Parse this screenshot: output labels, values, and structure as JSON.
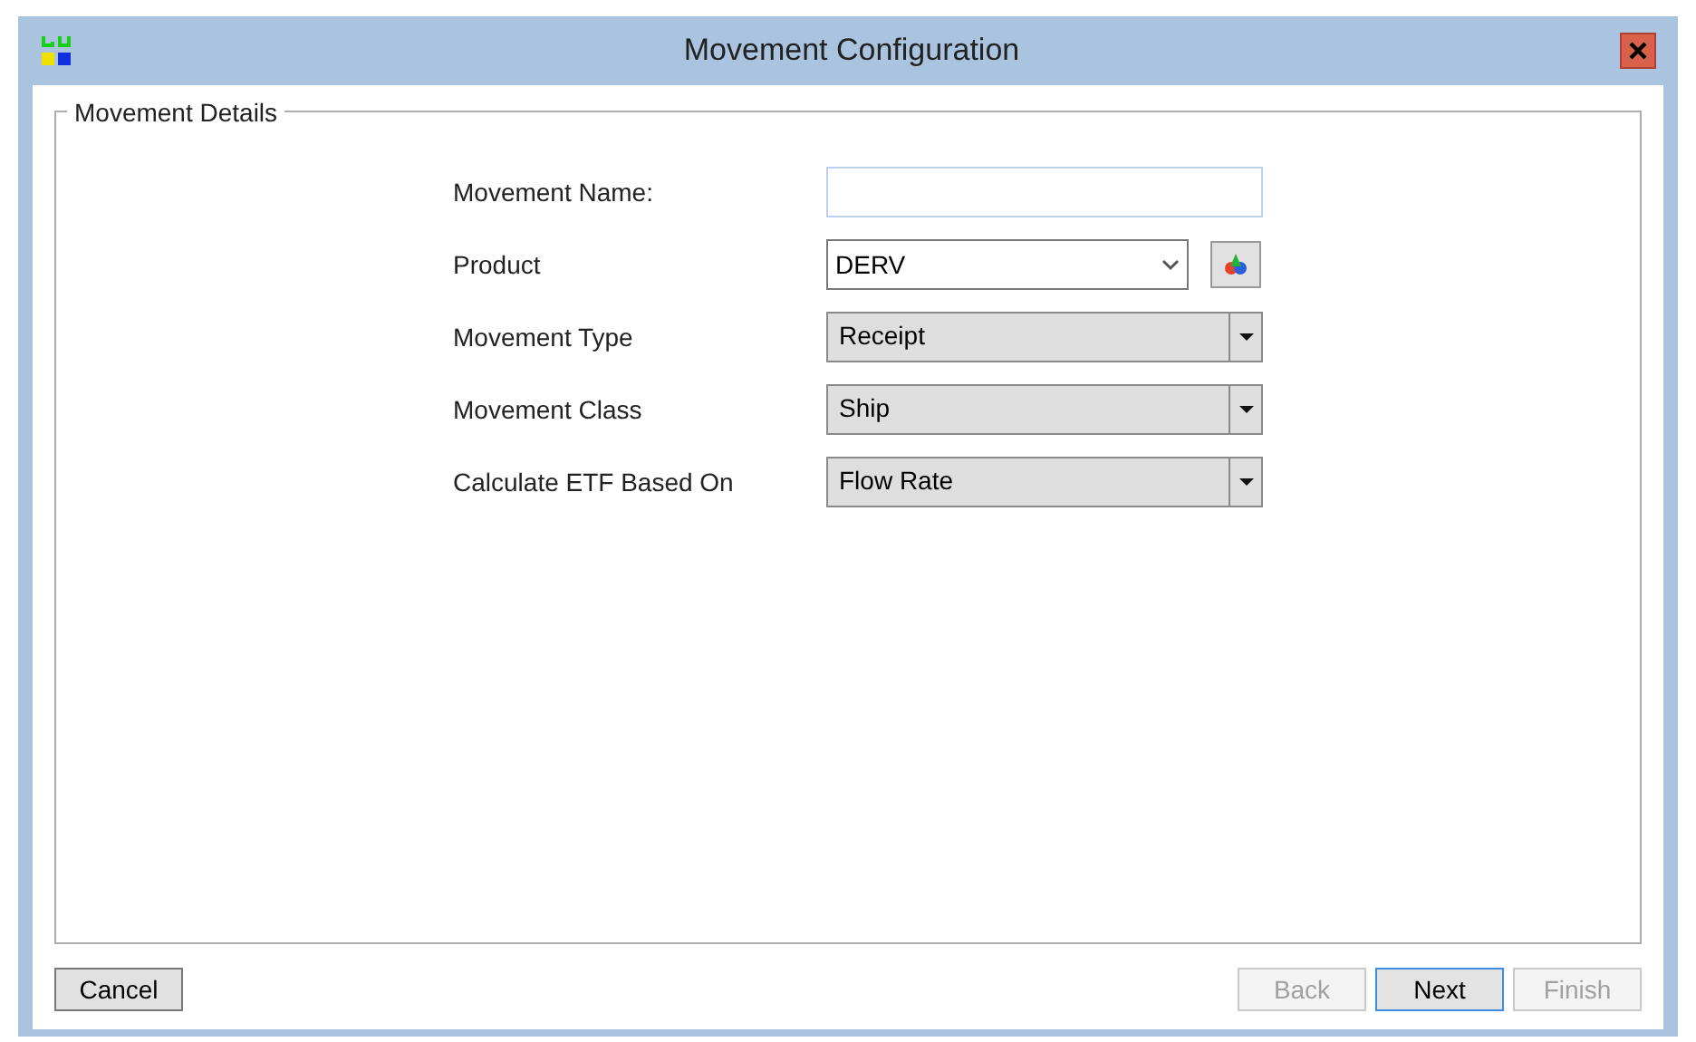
{
  "window": {
    "title": "Movement Configuration"
  },
  "group": {
    "title": "Movement Details"
  },
  "fields": [
    {
      "label": "Movement Name:",
      "kind": "text"
    },
    {
      "label": "Product",
      "kind": "combo",
      "value": "DERV"
    },
    {
      "label": "Movement Type",
      "kind": "select",
      "value": "Receipt"
    },
    {
      "label": "Movement Class",
      "kind": "select",
      "value": "Ship"
    },
    {
      "label": "Calculate ETF Based On",
      "kind": "select",
      "value": "Flow Rate"
    }
  ],
  "buttons_left": [
    {
      "label": "Cancel",
      "disabled": false,
      "focused": false
    }
  ],
  "buttons_right": [
    {
      "label": "Back",
      "disabled": true,
      "focused": false
    },
    {
      "label": "Next",
      "disabled": false,
      "focused": true
    },
    {
      "label": "Finish",
      "disabled": true,
      "focused": false
    }
  ]
}
